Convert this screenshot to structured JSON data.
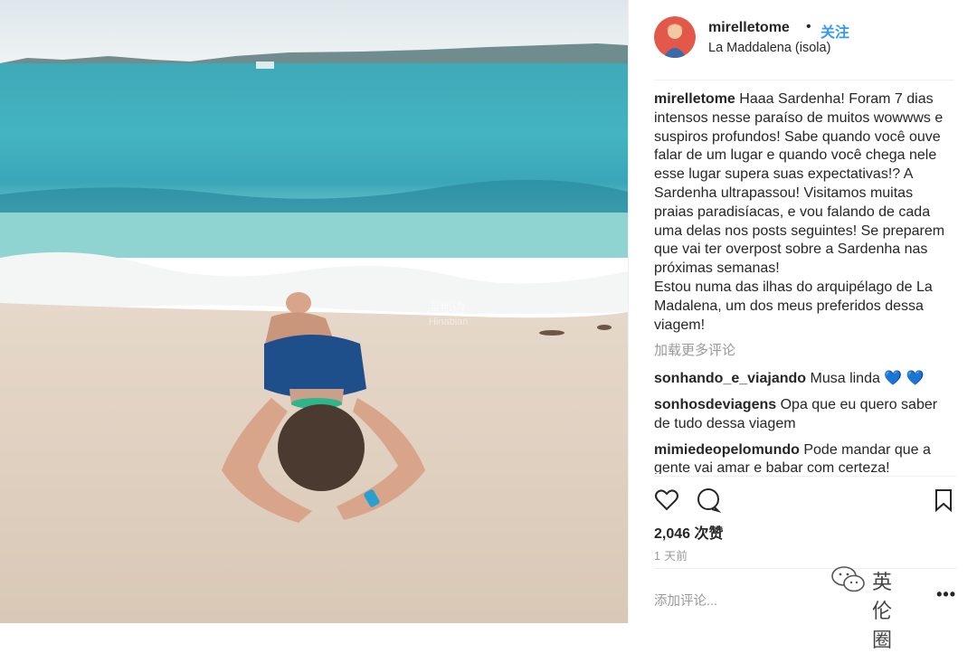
{
  "post": {
    "username": "mirelletome",
    "dot": "•",
    "follow_label": "关注",
    "location": "La Maddalena (isola)",
    "caption_user": "mirelletome",
    "caption_text": "Haaa Sardenha! Foram 7 dias intensos nesse paraíso de muitos wowwws e suspiros profundos! Sabe quando você ouve falar de um lugar e quando você chega nele esse lugar supera suas expectativas!? A Sardenha ultrapassou! Visitamos muitas praias paradisíacas, e vou falando de cada uma delas nos posts seguintes! Se preparem que vai ter overpost sobre a Sardenha nas próximas semanas!",
    "caption_text2": "Estou numa das ilhas do arquipélago de La Madalena, um dos meus preferidos dessa viagem!",
    "load_more": "加载更多评论",
    "comments": [
      {
        "user": "sonhando_e_viajando",
        "text": "Musa linda",
        "emoji": "💙 💙"
      },
      {
        "user": "sonhosdeviagens",
        "text": "Opa que eu quero saber de tudo dessa viagem",
        "emoji": ""
      },
      {
        "user": "mimiedeopelomundo",
        "text": "Pode mandar que a gente vai amar e babar com certeza!",
        "emoji": ""
      }
    ],
    "likes": "2,046 次赞",
    "time": "1 天前",
    "add_comment_placeholder": "添加评论...",
    "more_options": "•••"
  },
  "watermark": {
    "brand": "英伦圈",
    "photo_mark": "海那边",
    "photo_mark_sub": "Hinabian"
  },
  "icons": [
    "heart-icon",
    "comment-icon",
    "bookmark-icon",
    "wechat-icon"
  ],
  "colors": {
    "link_blue": "#3897f0",
    "muted": "#999999",
    "text": "#262626"
  }
}
